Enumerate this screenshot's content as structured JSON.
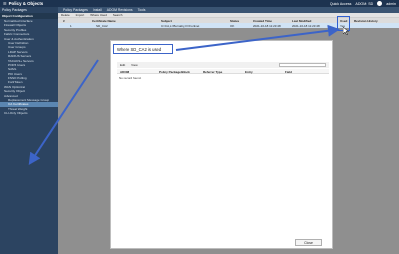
{
  "topbar": {
    "title": "Policy & Objects",
    "quick_access": "Quick Access",
    "adom": "ADOM: SD",
    "user": "admin"
  },
  "menubar": {
    "selector": "Policy Packages",
    "items": [
      "Policy Packages",
      "Install",
      "ADOM Revisions",
      "Tools"
    ]
  },
  "sidebar": {
    "header": "Object Configuration",
    "items": [
      {
        "label": "Normalized Interface",
        "sub": false
      },
      {
        "label": "Firewall Objects",
        "sub": false
      },
      {
        "label": "Security Profiles",
        "sub": false
      },
      {
        "label": "Fabric Connectors",
        "sub": false
      },
      {
        "label": "User & Authentication",
        "sub": false
      },
      {
        "label": "User Definition",
        "sub": true
      },
      {
        "label": "User Groups",
        "sub": true
      },
      {
        "label": "LDAP Servers",
        "sub": true
      },
      {
        "label": "RADIUS Servers",
        "sub": true
      },
      {
        "label": "TACACS+ Servers",
        "sub": true
      },
      {
        "label": "POP3 Users",
        "sub": true
      },
      {
        "label": "SAML",
        "sub": true
      },
      {
        "label": "PKI Users",
        "sub": true
      },
      {
        "label": "FSSO Polling",
        "sub": true
      },
      {
        "label": "FortiToken",
        "sub": true
      },
      {
        "label": "WAN Optimizat",
        "sub": false
      },
      {
        "label": "Security Object",
        "sub": false
      },
      {
        "label": "Advanced",
        "sub": false
      },
      {
        "label": "Replacement Message Group",
        "sub": true
      },
      {
        "label": "CA Certificates",
        "sub": true,
        "active": true
      },
      {
        "label": "Threat Weight",
        "sub": true
      },
      {
        "label": "CLI-Only Objects",
        "sub": false
      }
    ]
  },
  "toolbar": {
    "items": [
      "Delete",
      "Import",
      "Where Used",
      "Search"
    ]
  },
  "table": {
    "columns": [
      "#",
      "Certificate Name",
      "Subject",
      "Status",
      "Created Time",
      "Last Modified",
      "Used",
      "Revision History"
    ],
    "row": [
      "1",
      "SD_CA2",
      "C=CA,L=Burnaby,O=Fortinet",
      "OK",
      "2021-10-18 11:23:48",
      "2021-10-18 11:23:48",
      "Yes",
      ""
    ]
  },
  "dialog": {
    "title": "Where SD_CA2 is used",
    "tools": [
      "Edit",
      "View"
    ],
    "columns": [
      "ADOM",
      "Policy Package/Block",
      "Referrer Type",
      "Entry",
      "Field"
    ],
    "empty": "No record found.",
    "close_label": "Close"
  },
  "colors": {
    "topbar": "#1d3350",
    "sidebar": "#2c4461",
    "active": "#5b86b1",
    "highlight": "#3c64c8"
  }
}
